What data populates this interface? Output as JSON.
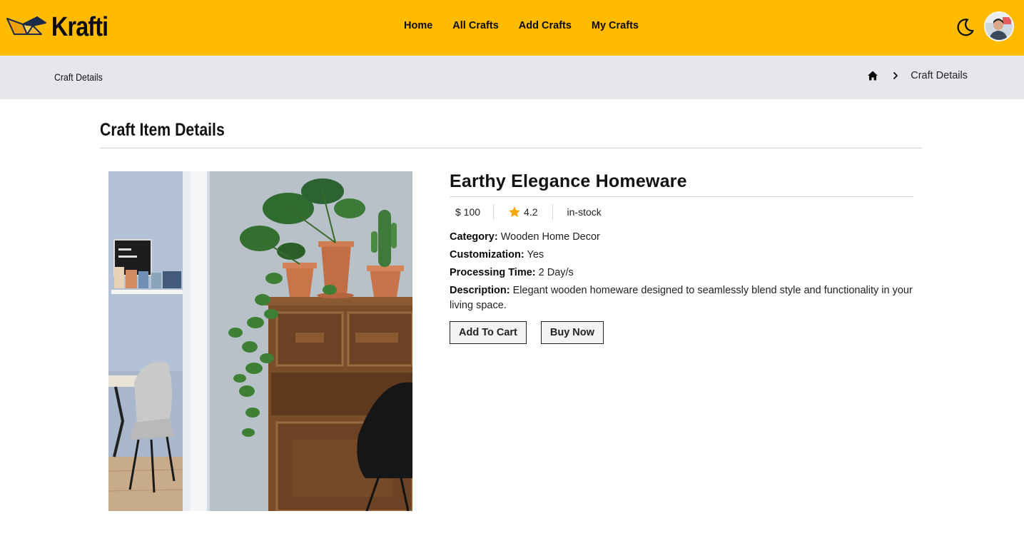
{
  "brand": {
    "name": "Krafti",
    "logo_icon": "origami-bird-icon"
  },
  "nav": {
    "links": [
      {
        "label": "Home"
      },
      {
        "label": "All Crafts"
      },
      {
        "label": "Add Crafts"
      },
      {
        "label": "My Crafts"
      }
    ],
    "theme_toggle_icon": "moon-icon",
    "avatar_icon": "user-avatar"
  },
  "breadcrumb": {
    "page_title": "Craft Details",
    "home_icon": "home-icon",
    "separator_icon": "chevron-right-icon",
    "current": "Craft Details"
  },
  "section": {
    "title": "Craft Item Details"
  },
  "product": {
    "image_description_icon": "product-photo",
    "title": "Earthy Elegance Homeware",
    "price": "$ 100",
    "rating": "4.2",
    "stock": "in-stock",
    "category_label": "Category:",
    "category": "Wooden Home Decor",
    "customization_label": "Customization:",
    "customization": "Yes",
    "processing_label": "Processing Time:",
    "processing": "2 Day/s",
    "description_label": "Description:",
    "description": "Elegant wooden homeware designed to seamlessly blend style and functionality in your living space.",
    "add_to_cart": "Add To Cart",
    "buy_now": "Buy Now"
  },
  "colors": {
    "navbar": "#FFBB00",
    "breadcrumb_bar": "#E5E7EB",
    "star": "#F5A800"
  }
}
